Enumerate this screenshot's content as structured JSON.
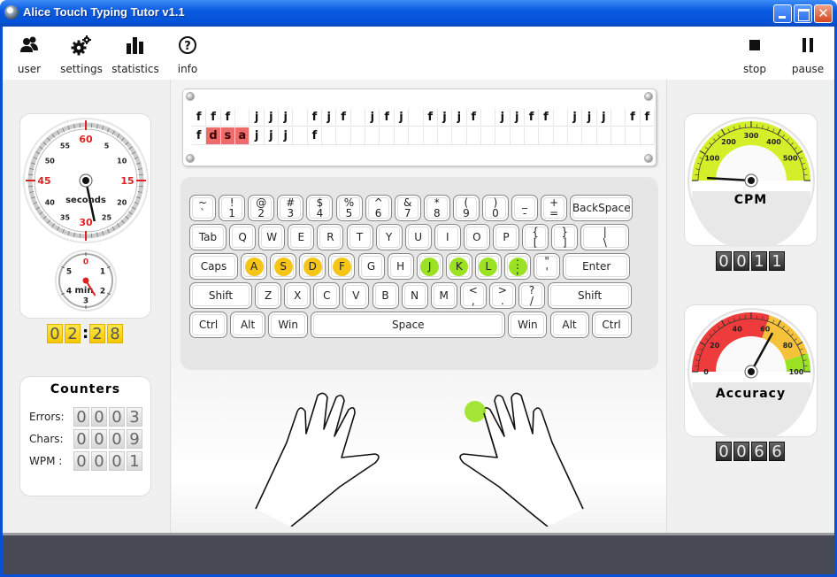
{
  "window": {
    "title": "Alice Touch Typing Tutor v1.1",
    "controls": {
      "minimize": "minimize",
      "maximize": "maximize",
      "close": "✕"
    }
  },
  "toolbar": {
    "left": [
      {
        "label": "user",
        "icon": "users-icon"
      },
      {
        "label": "settings",
        "icon": "gears-icon"
      },
      {
        "label": "statistics",
        "icon": "bar-chart-icon"
      },
      {
        "label": "info",
        "icon": "question-icon"
      }
    ],
    "right": [
      {
        "label": "stop",
        "icon": "stop-icon"
      },
      {
        "label": "pause",
        "icon": "pause-icon"
      }
    ]
  },
  "timer": {
    "seconds_dial": {
      "label": "seconds",
      "ticks": [
        "60",
        "5",
        "10",
        "15",
        "20",
        "25",
        "30",
        "35",
        "40",
        "45",
        "50",
        "55"
      ],
      "value": 28
    },
    "minutes_dial": {
      "label": "min",
      "ticks": [
        "0",
        "1",
        "2",
        "3",
        "4",
        "5"
      ],
      "value": 2.47
    },
    "display": [
      "0",
      "2",
      ":",
      "2",
      "8"
    ]
  },
  "counters": {
    "title": "Counters",
    "rows": [
      {
        "label": "Errors:",
        "digits": [
          "0",
          "0",
          "0",
          "3"
        ]
      },
      {
        "label": "Chars:",
        "digits": [
          "0",
          "0",
          "0",
          "9"
        ]
      },
      {
        "label": "WPM :",
        "digits": [
          "0",
          "0",
          "0",
          "1"
        ]
      }
    ]
  },
  "text_board": {
    "target_line": [
      "f",
      "f",
      "f",
      " ",
      "j",
      "j",
      "j",
      " ",
      "f",
      "j",
      "f",
      " ",
      "j",
      "f",
      "j",
      " ",
      "f",
      "j",
      "j",
      "f",
      " ",
      "j",
      "j",
      "f",
      "f",
      " ",
      "j",
      "j",
      "j",
      " ",
      "f",
      "f"
    ],
    "typed_line": [
      {
        "ch": "f",
        "err": false
      },
      {
        "ch": "d",
        "err": true
      },
      {
        "ch": "s",
        "err": true
      },
      {
        "ch": "a",
        "err": true
      },
      {
        "ch": "j",
        "err": false
      },
      {
        "ch": "j",
        "err": false
      },
      {
        "ch": "j",
        "err": false
      },
      {
        "ch": " ",
        "err": false
      },
      {
        "ch": "f",
        "err": false
      }
    ]
  },
  "keyboard": {
    "rows": [
      [
        {
          "t": "~",
          "b": "`"
        },
        {
          "t": "!",
          "b": "1"
        },
        {
          "t": "@",
          "b": "2"
        },
        {
          "t": "#",
          "b": "3"
        },
        {
          "t": "$",
          "b": "4"
        },
        {
          "t": "%",
          "b": "5"
        },
        {
          "t": "^",
          "b": "6"
        },
        {
          "t": "&",
          "b": "7"
        },
        {
          "t": "*",
          "b": "8"
        },
        {
          "t": "(",
          "b": "9"
        },
        {
          "t": ")",
          "b": "0"
        },
        {
          "t": "_",
          "b": "-"
        },
        {
          "t": "+",
          "b": "="
        },
        {
          "l": "BackSpace"
        }
      ],
      [
        {
          "l": "Tab"
        },
        {
          "l": "Q"
        },
        {
          "l": "W"
        },
        {
          "l": "E"
        },
        {
          "l": "R"
        },
        {
          "l": "T"
        },
        {
          "l": "Y"
        },
        {
          "l": "U"
        },
        {
          "l": "I"
        },
        {
          "l": "O"
        },
        {
          "l": "P"
        },
        {
          "t": "{",
          "b": "["
        },
        {
          "t": "}",
          "b": "]"
        },
        {
          "t": "|",
          "b": "\\"
        }
      ],
      [
        {
          "l": "Caps"
        },
        {
          "l": "A",
          "h": "yellow"
        },
        {
          "l": "S",
          "h": "yellow"
        },
        {
          "l": "D",
          "h": "yellow"
        },
        {
          "l": "F",
          "h": "yellow"
        },
        {
          "l": "G"
        },
        {
          "l": "H"
        },
        {
          "l": "J",
          "h": "green"
        },
        {
          "l": "K",
          "h": "green"
        },
        {
          "l": "L",
          "h": "green"
        },
        {
          "t": ":",
          "b": ";",
          "h": "green"
        },
        {
          "t": "\"",
          "b": "'"
        },
        {
          "l": "Enter"
        }
      ],
      [
        {
          "l": "Shift"
        },
        {
          "l": "Z"
        },
        {
          "l": "X"
        },
        {
          "l": "C"
        },
        {
          "l": "V"
        },
        {
          "l": "B"
        },
        {
          "l": "N"
        },
        {
          "l": "M"
        },
        {
          "t": "<",
          "b": ","
        },
        {
          "t": ">",
          "b": "."
        },
        {
          "t": "?",
          "b": "/"
        },
        {
          "l": "Shift"
        }
      ],
      [
        {
          "l": "Ctrl"
        },
        {
          "l": "Alt"
        },
        {
          "l": "Win"
        },
        {
          "l": "Space"
        },
        {
          "l": "Win"
        },
        {
          "l": "Alt"
        },
        {
          "l": "Ctrl"
        }
      ]
    ],
    "highlight_colors": {
      "yellow": "#f5c518",
      "green": "#9be222"
    }
  },
  "hands": {
    "active_finger": "right-index",
    "indicator_color": "#9be222"
  },
  "cpm_gauge": {
    "label": "CPM",
    "ticks": [
      "100",
      "200",
      "300",
      "400",
      "500"
    ],
    "range": [
      0,
      600
    ],
    "value": 11,
    "display": [
      "0",
      "0",
      "1",
      "1"
    ],
    "color": "#d4ef2a"
  },
  "accuracy_gauge": {
    "label": "Accuracy",
    "ticks": [
      "0",
      "20",
      "40",
      "60",
      "80",
      "100"
    ],
    "range": [
      0,
      100
    ],
    "value": 66,
    "display": [
      "0",
      "0",
      "6",
      "6"
    ],
    "zones": [
      {
        "from": 0,
        "to": 60,
        "color": "#ee3b3b"
      },
      {
        "from": 60,
        "to": 90,
        "color": "#f6c23a"
      },
      {
        "from": 90,
        "to": 100,
        "color": "#9be222"
      }
    ]
  }
}
